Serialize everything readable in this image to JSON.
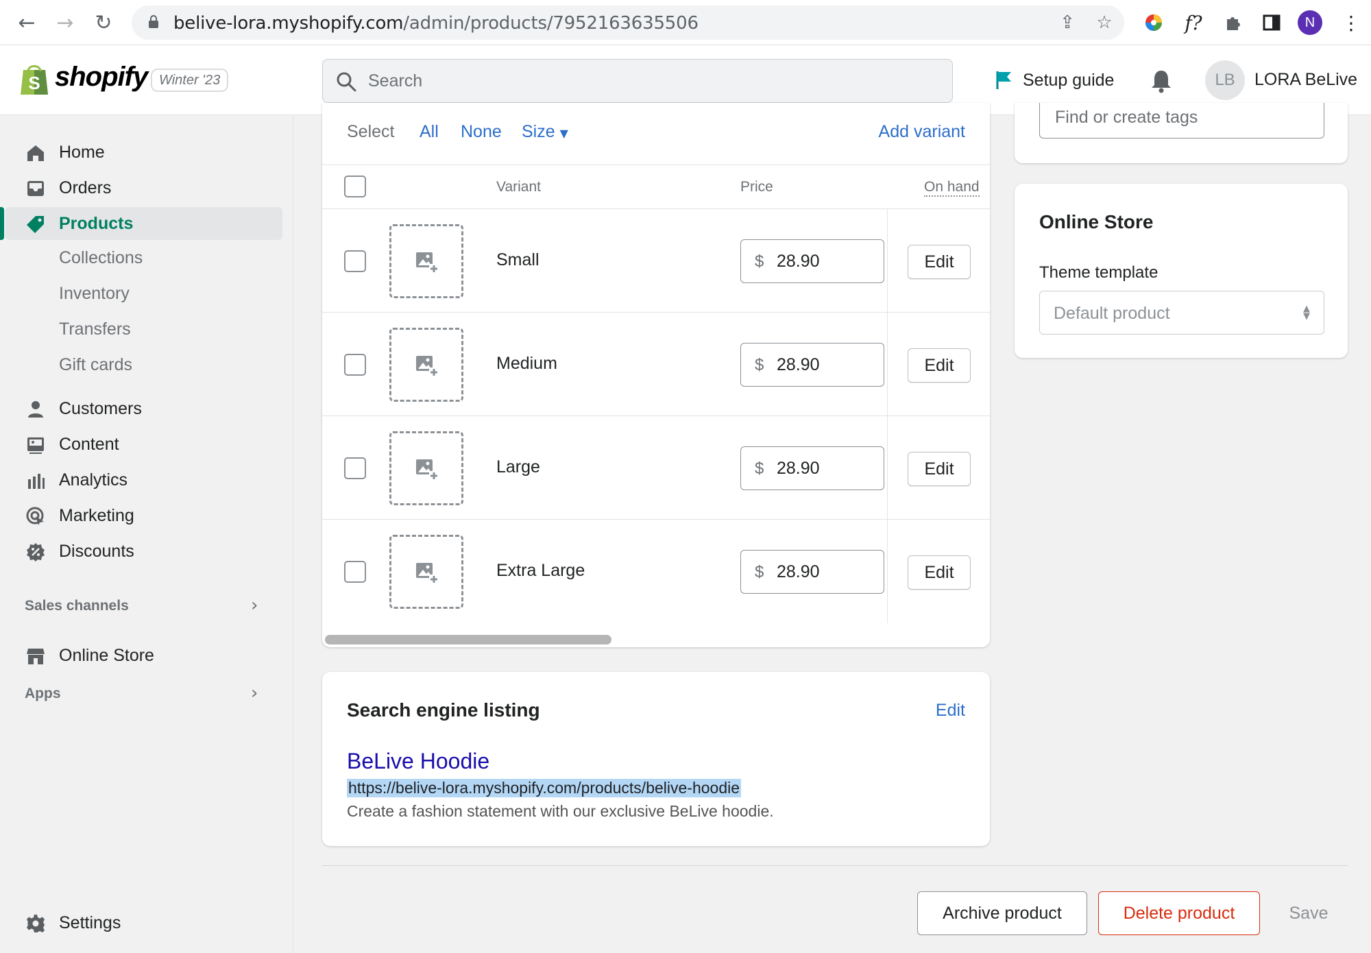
{
  "browser": {
    "url_host": "belive-lora.myshopify.com",
    "url_path": "/admin/products/7952163635506",
    "profile_initial": "N",
    "extension_text": "f?"
  },
  "topbar": {
    "brand": "shopify",
    "edition": "Winter '23",
    "search_placeholder": "Search",
    "setup_guide": "Setup guide",
    "avatar_initials": "LB",
    "username": "LORA BeLive",
    "accent_color": "#008060"
  },
  "sidebar": {
    "items": [
      {
        "label": "Home",
        "icon": "home-icon"
      },
      {
        "label": "Orders",
        "icon": "orders-icon"
      },
      {
        "label": "Products",
        "icon": "tag-icon",
        "active": true
      },
      {
        "label": "Customers",
        "icon": "person-icon"
      },
      {
        "label": "Content",
        "icon": "content-icon"
      },
      {
        "label": "Analytics",
        "icon": "bar-chart-icon"
      },
      {
        "label": "Marketing",
        "icon": "target-icon"
      },
      {
        "label": "Discounts",
        "icon": "discount-icon"
      }
    ],
    "product_subitems": [
      "Collections",
      "Inventory",
      "Transfers",
      "Gift cards"
    ],
    "sales_channels_label": "Sales channels",
    "online_store": "Online Store",
    "apps_label": "Apps",
    "settings": "Settings"
  },
  "variants": {
    "select_label": "Select",
    "all": "All",
    "none": "None",
    "size_filter": "Size",
    "add_variant": "Add variant",
    "columns": {
      "variant": "Variant",
      "price": "Price",
      "on_hand": "On hand"
    },
    "rows": [
      {
        "name": "Small",
        "currency": "$",
        "price": "28.90",
        "action": "Edit"
      },
      {
        "name": "Medium",
        "currency": "$",
        "price": "28.90",
        "action": "Edit"
      },
      {
        "name": "Large",
        "currency": "$",
        "price": "28.90",
        "action": "Edit"
      },
      {
        "name": "Extra Large",
        "currency": "$",
        "price": "28.90",
        "action": "Edit"
      }
    ]
  },
  "seo": {
    "title": "Search engine listing",
    "edit": "Edit",
    "product_title": "BeLive Hoodie",
    "url": "https://belive-lora.myshopify.com/products/belive-hoodie",
    "description": "Create a fashion statement with our exclusive BeLive hoodie."
  },
  "tags": {
    "placeholder": "Find or create tags"
  },
  "online_store_card": {
    "title": "Online Store",
    "theme_label": "Theme template",
    "theme_value": "Default product"
  },
  "footer": {
    "archive": "Archive product",
    "delete": "Delete product",
    "save": "Save"
  }
}
